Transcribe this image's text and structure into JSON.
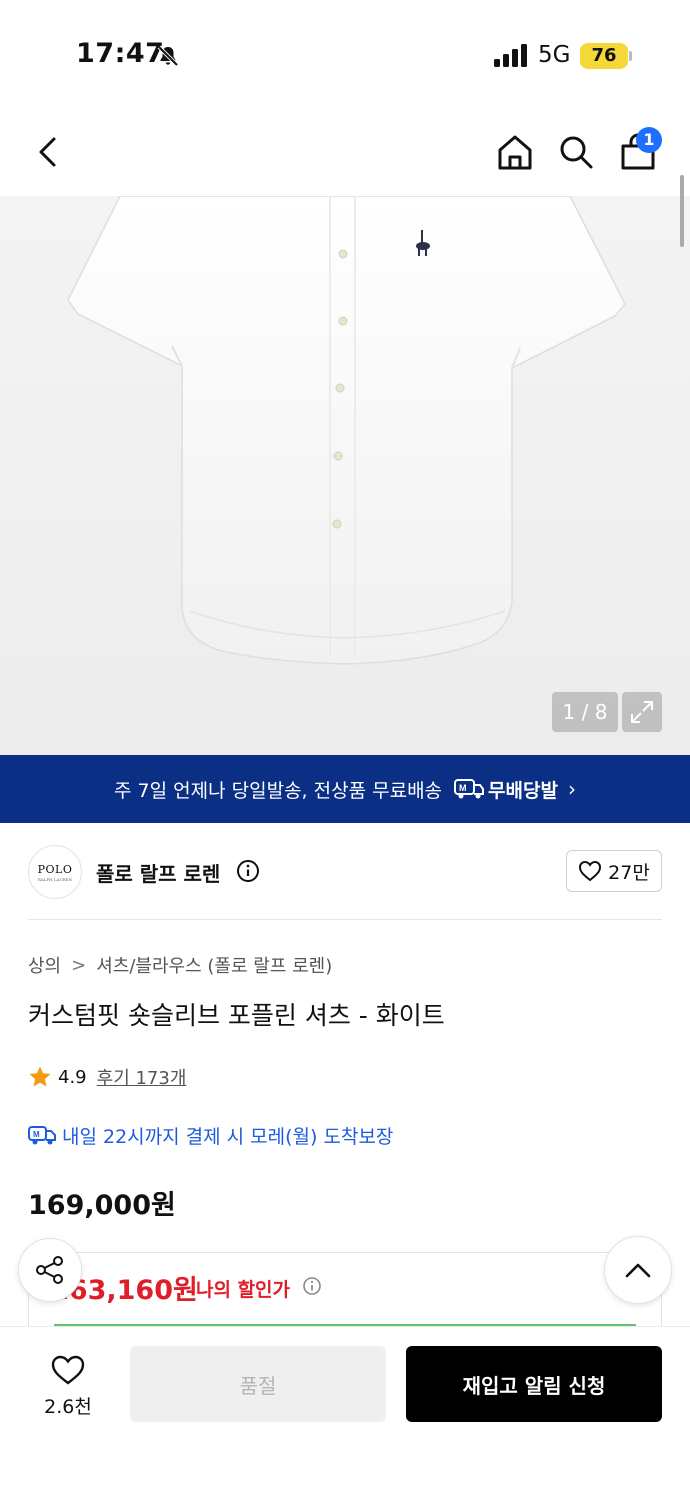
{
  "status_bar": {
    "time": "17:47",
    "network": "5G",
    "battery": "76",
    "icons": [
      "bell-slash-icon",
      "signal-bars-icon",
      "battery-icon"
    ]
  },
  "top_nav": {
    "icons": [
      "back-arrow-icon",
      "home-icon",
      "search-icon",
      "shopping-bag-icon"
    ],
    "cart_badge": "1"
  },
  "gallery": {
    "counter": "1 / 8",
    "expand_icon": "expand-arrows-icon"
  },
  "delivery_banner": {
    "text": "주 7일 언제나 당일발송, 전상품 무료배송",
    "brand_label": "무배당발",
    "chevron": "›",
    "icon": "truck-m-icon"
  },
  "brand": {
    "logo_text": "POLO",
    "logo_sub": "RALPH LAUREN",
    "name": "폴로 랄프 로렌",
    "likes": "27만"
  },
  "breadcrumb": {
    "category": "상의",
    "separator": ">",
    "subcategory": "셔츠/블라우스 (폴로 랄프 로렌)"
  },
  "product": {
    "title": "커스텀핏 숏슬리브 포플린 셔츠 - 화이트",
    "rating": "4.9",
    "reviews": "후기 173개",
    "arrival": "내일 22시까지 결제 시 모레(월) 도착보장",
    "price": "169,000원",
    "discount_price": "163,160원",
    "discount_label": "나의 할인가"
  },
  "bottom_bar": {
    "wish_count": "2.6천",
    "soldout_label": "품절",
    "restock_label": "재입고 알림 신청"
  },
  "colors": {
    "banner_bg": "#0b2f84",
    "discount_red": "#e01e2a",
    "link_blue": "#1d5be0",
    "badge_blue": "#1f6fff",
    "battery_yellow": "#f5d738"
  }
}
